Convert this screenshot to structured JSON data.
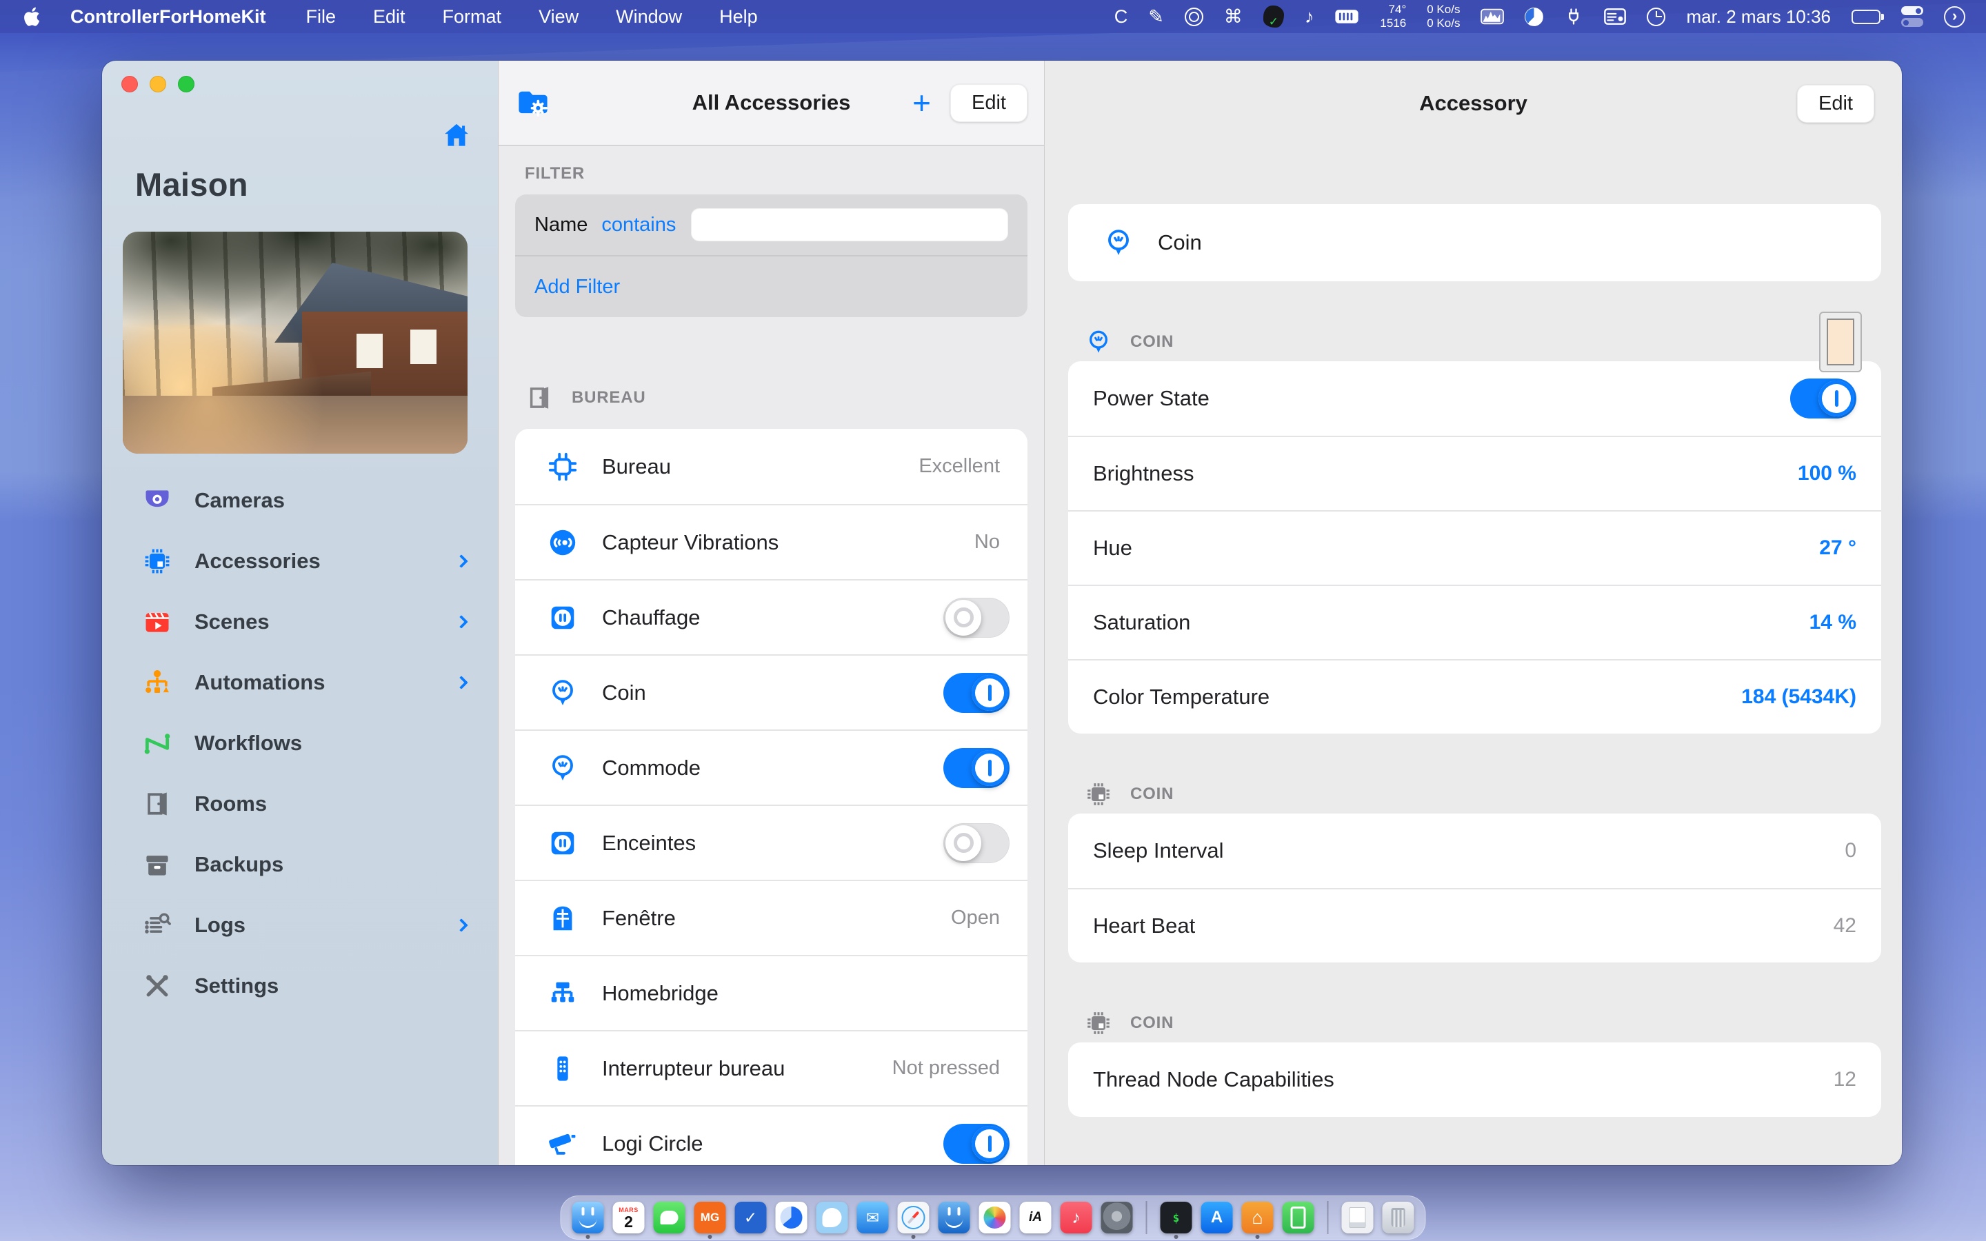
{
  "colors": {
    "accent": "#0a7cff",
    "menu_bar": "#3c4cb2",
    "sidebar_bg": "#cbd7e3",
    "panel_bg": "#ebebed",
    "card_bg": "#ffffff",
    "muted_text": "#8e8e93",
    "toggle_off": "#e4e4e7",
    "color_well": "#fbe6cf"
  },
  "menu_bar": {
    "app_name": "ControllerForHomeKit",
    "menus": [
      "File",
      "Edit",
      "Format",
      "View",
      "Window",
      "Help"
    ],
    "status_items": [
      {
        "name": "c-app-status-icon",
        "type": "glyph",
        "glyph": "C"
      },
      {
        "name": "pencil-status-icon",
        "type": "glyph",
        "glyph": "✎"
      },
      {
        "name": "power-status-icon",
        "type": "power"
      },
      {
        "name": "command-status-icon",
        "type": "glyph",
        "glyph": "⌘"
      },
      {
        "name": "vpn-blob-status-icon",
        "type": "blob"
      },
      {
        "name": "music-status-icon",
        "type": "glyph",
        "glyph": "♪"
      },
      {
        "name": "keyboard-status-icon",
        "type": "keyboard"
      },
      {
        "name": "weather-widget",
        "type": "text2",
        "top": "74°",
        "bottom": "1516"
      },
      {
        "name": "network-speed-widget",
        "type": "text2",
        "top": "0 Ko/s",
        "bottom": "0 Ko/s"
      },
      {
        "name": "activity-graph-status-icon",
        "type": "graph"
      },
      {
        "name": "disk-pie-status-icon",
        "type": "pie"
      },
      {
        "name": "plug-status-icon",
        "type": "plug"
      },
      {
        "name": "clipboard-status-icon",
        "type": "winlist"
      },
      {
        "name": "history-clock-status-icon",
        "type": "clock"
      },
      {
        "name": "menu-clock",
        "type": "text",
        "text": "mar. 2 mars 10:36"
      },
      {
        "name": "battery-status-icon",
        "type": "battery"
      },
      {
        "name": "toggles-status-icon",
        "type": "toggles"
      },
      {
        "name": "control-center-chevron-icon",
        "type": "chevron",
        "glyph": "›"
      }
    ]
  },
  "window": {
    "sidebar": {
      "home_name": "Maison",
      "items": [
        {
          "label": "Cameras",
          "icon": "camera-dome-icon",
          "svg": "camera-dome",
          "color": "#6460d8",
          "chevron": false
        },
        {
          "label": "Accessories",
          "icon": "chip-icon",
          "svg": "chip",
          "color": "#0a7cff",
          "chevron": true
        },
        {
          "label": "Scenes",
          "icon": "clapperboard-icon",
          "svg": "clapper",
          "color": "#ff3b30",
          "chevron": true
        },
        {
          "label": "Automations",
          "icon": "automation-tree-icon",
          "svg": "org",
          "color": "#ff9500",
          "chevron": true
        },
        {
          "label": "Workflows",
          "icon": "workflow-icon",
          "svg": "zigzag",
          "color": "#34c759",
          "chevron": false
        },
        {
          "label": "Rooms",
          "icon": "door-icon",
          "svg": "door",
          "color": "#686d73",
          "chevron": false
        },
        {
          "label": "Backups",
          "icon": "archive-box-icon",
          "svg": "box",
          "color": "#686d73",
          "chevron": false
        },
        {
          "label": "Logs",
          "icon": "logs-icon",
          "svg": "logs",
          "color": "#686d73",
          "chevron": true
        },
        {
          "label": "Settings",
          "icon": "tools-icon",
          "svg": "tools",
          "color": "#686d73",
          "chevron": false
        }
      ]
    },
    "list_panel": {
      "title": "All Accessories",
      "add_label": "+",
      "edit_label": "Edit",
      "filter": {
        "section_label": "FILTER",
        "field_label": "Name",
        "operator": "contains",
        "input_value": "",
        "add_filter_label": "Add Filter"
      },
      "group": {
        "label": "BUREAU",
        "icon": "door-icon"
      },
      "rows": [
        {
          "name": "Bureau",
          "icon": "bridge-chip-icon",
          "svg": "bridge",
          "right_type": "text",
          "right_value": "Excellent"
        },
        {
          "name": "Capteur Vibrations",
          "icon": "vibration-sensor-icon",
          "svg": "vibration",
          "right_type": "text",
          "right_value": "No"
        },
        {
          "name": "Chauffage",
          "icon": "outlet-icon",
          "svg": "outlet",
          "right_type": "toggle",
          "right_value": "off"
        },
        {
          "name": "Coin",
          "icon": "lightbulb-icon",
          "svg": "lightbulb",
          "right_type": "toggle",
          "right_value": "on"
        },
        {
          "name": "Commode",
          "icon": "lightbulb-icon",
          "svg": "lightbulb",
          "right_type": "toggle",
          "right_value": "on"
        },
        {
          "name": "Enceintes",
          "icon": "outlet-icon",
          "svg": "outlet",
          "right_type": "toggle",
          "right_value": "off"
        },
        {
          "name": "Fenêtre",
          "icon": "window-icon",
          "svg": "window-arch",
          "right_type": "text",
          "right_value": "Open"
        },
        {
          "name": "Homebridge",
          "icon": "homebridge-icon",
          "svg": "tree",
          "right_type": "none",
          "right_value": ""
        },
        {
          "name": "Interrupteur bureau",
          "icon": "remote-icon",
          "svg": "remote",
          "right_type": "text",
          "right_value": "Not pressed"
        },
        {
          "name": "Logi Circle",
          "icon": "cctv-camera-icon",
          "svg": "cctv",
          "right_type": "toggle",
          "right_value": "on"
        }
      ]
    },
    "detail_panel": {
      "title": "Accessory",
      "edit_label": "Edit",
      "accessory_card": {
        "name": "Coin",
        "icon": "lightbulb-icon"
      },
      "color_well": "#fbe6cf",
      "sections": [
        {
          "label": "COIN",
          "icon": "lightbulb-icon",
          "svg": "lightbulb",
          "icon_color": "#0a7cff",
          "has_color_well": true,
          "rows": [
            {
              "label": "Power State",
              "type": "toggle",
              "value": "on"
            },
            {
              "label": "Brightness",
              "type": "accent",
              "value": "100 %"
            },
            {
              "label": "Hue",
              "type": "accent",
              "value": "27 °"
            },
            {
              "label": "Saturation",
              "type": "accent",
              "value": "14 %"
            },
            {
              "label": "Color Temperature",
              "type": "accent",
              "value": "184 (5434K)"
            }
          ]
        },
        {
          "label": "COIN",
          "icon": "chip-icon",
          "svg": "chip",
          "icon_color": "#85858a",
          "has_color_well": false,
          "rows": [
            {
              "label": "Sleep Interval",
              "type": "muted",
              "value": "0"
            },
            {
              "label": "Heart Beat",
              "type": "muted",
              "value": "42"
            }
          ]
        },
        {
          "label": "COIN",
          "icon": "chip-icon",
          "svg": "chip",
          "icon_color": "#85858a",
          "has_color_well": false,
          "rows": [
            {
              "label": "Thread Node Capabilities",
              "type": "muted",
              "value": "12"
            }
          ]
        }
      ]
    }
  },
  "dock": {
    "items": [
      {
        "name": "finder-dock-icon",
        "style": "finder",
        "glyph": "",
        "dot": true
      },
      {
        "name": "calendar-dock-icon",
        "style": "cal",
        "top": "MARS",
        "day": "2",
        "dot": false
      },
      {
        "name": "messages-dock-icon",
        "style": "msg",
        "glyph": "",
        "dot": false
      },
      {
        "name": "mg-dock-icon",
        "style": "mg",
        "glyph": "MG",
        "dot": true
      },
      {
        "name": "things-dock-icon",
        "style": "things",
        "glyph": "✓",
        "dot": false
      },
      {
        "name": "timer-dock-icon",
        "style": "timer",
        "glyph": "",
        "dot": false
      },
      {
        "name": "twitter-dock-icon",
        "style": "twt",
        "glyph": "",
        "dot": false
      },
      {
        "name": "mail-dock-icon",
        "style": "mail",
        "glyph": "✉",
        "dot": false
      },
      {
        "name": "safari-dock-icon",
        "style": "safari",
        "glyph": "",
        "dot": true
      },
      {
        "name": "finder-alt-dock-icon",
        "style": "finder2",
        "glyph": "",
        "dot": false
      },
      {
        "name": "photos-dock-icon",
        "style": "photos",
        "glyph": "",
        "dot": false
      },
      {
        "name": "ia-writer-dock-icon",
        "style": "ia",
        "glyph": "iA",
        "dot": false
      },
      {
        "name": "music-dock-icon",
        "style": "music",
        "glyph": "♪",
        "dot": false
      },
      {
        "name": "preferences-dock-icon",
        "style": "prefs",
        "glyph": "",
        "dot": false
      },
      {
        "sep": true
      },
      {
        "name": "terminal-dock-icon",
        "style": "term",
        "glyph": "$",
        "dot": true
      },
      {
        "name": "app-store-dock-icon",
        "style": "as",
        "glyph": "A",
        "dot": false
      },
      {
        "name": "controller-home-dock-icon",
        "style": "home",
        "glyph": "⌂",
        "dot": true
      },
      {
        "name": "device-link-dock-icon",
        "style": "link",
        "glyph": "",
        "dot": false
      },
      {
        "sep": true
      },
      {
        "name": "installer-dock-icon",
        "style": "doc",
        "glyph": "",
        "dot": false
      },
      {
        "name": "trash-dock-icon",
        "style": "trash",
        "glyph": "",
        "dot": false
      }
    ]
  }
}
